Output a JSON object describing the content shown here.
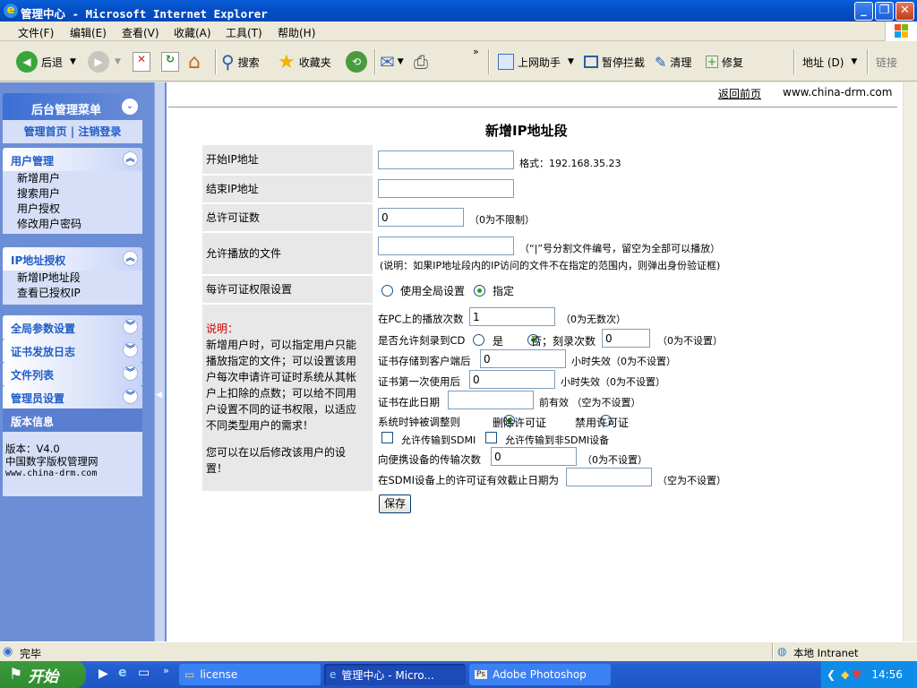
{
  "window": {
    "title": "管理中心 - Microsoft Internet Explorer"
  },
  "menu": [
    "文件(F)",
    "编辑(E)",
    "查看(V)",
    "收藏(A)",
    "工具(T)",
    "帮助(H)"
  ],
  "toolbar": {
    "back": "后退",
    "search": "搜索",
    "favorites": "收藏夹",
    "helper": "上网助手",
    "block": "暂停拦截",
    "clean": "清理",
    "repair": "修复",
    "address": "地址 (D)",
    "links": "链接"
  },
  "sidebar": {
    "header": "后台管理菜单",
    "top_links": [
      "管理首页",
      "注销登录"
    ],
    "sections": [
      {
        "title": "用户管理",
        "items": [
          "新增用户",
          "搜索用户",
          "用户授权",
          "修改用户密码"
        ]
      },
      {
        "title": "IP地址授权",
        "items": [
          "新增IP地址段",
          "查看已授权IP"
        ]
      },
      {
        "title": "全局参数设置",
        "items": []
      },
      {
        "title": "证书发放日志",
        "items": []
      },
      {
        "title": "文件列表",
        "items": []
      },
      {
        "title": "管理员设置",
        "items": []
      }
    ],
    "version": {
      "title": "版本信息",
      "line1": "版本：V4.0",
      "line2": "中国数字版权管理网",
      "line3": "www.china-drm.com"
    }
  },
  "page": {
    "back_link": "返回前页",
    "site": "www.china-drm.com",
    "title": "新增IP地址段",
    "start_ip_label": "开始IP地址",
    "start_ip_value": "",
    "format_hint": "格式：192.168.35.23",
    "end_ip_label": "结束IP地址",
    "end_ip_value": "",
    "total_label": "总许可证数",
    "total_value": "0",
    "total_hint": "（0为不限制）",
    "files_label": "允许播放的文件",
    "files_value": "",
    "files_hint": "（“|”号分割文件编号，留空为全部可以播放）",
    "files_note": "(说明：如果IP地址段内的IP访问的文件不在指定的范围内，则弹出身份验证框)",
    "rights_label": "每许可证权限设置",
    "opt_global": "使用全局设置",
    "opt_custom": "指定",
    "note_title": "说明：",
    "note_body": "新增用户时，可以指定用户只能播放指定的文件；可以设置该用户每次申请许可证时系统从其帐户上扣除的点数；可以给不同用户设置不同的证书权限，以适应不同类型用户的需求！",
    "note_tail": "您可以在以后修改该用户的设置！",
    "pc_label": "在PC上的播放次数",
    "pc_value": "1",
    "pc_hint": "（0为无数次）",
    "burn_label": "是否允许刻录到CD",
    "yes": "是",
    "no": "否；刻录次数",
    "burn_value": "0",
    "burn_hint": "（0为不设置）",
    "store_label": "证书存储到客户端后",
    "store_value": "0",
    "store_hint": "小时失效（0为不设置）",
    "first_label": "证书第一次使用后",
    "first_value": "0",
    "first_hint": "小时失效（0为不设置）",
    "date_label": "证书在此日期",
    "date_value": "",
    "date_hint": "前有效 （空为不设置）",
    "clock_label": "系统时钟被调整则",
    "del_lic": "删除许可证",
    "dis_lic": "禁用许可证",
    "sdmi": "允许传输到SDMI",
    "nonsdmi": "允许传输到非SDMI设备",
    "portable_label": "向便携设备的传输次数",
    "portable_value": "0",
    "portable_hint": "（0为不设置）",
    "sdmi_date_label": "在SDMI设备上的许可证有效截止日期为",
    "sdmi_date_value": "",
    "sdmi_date_hint": "（空为不设置）",
    "save": "保存"
  },
  "status": {
    "left": "完毕",
    "zone": "本地 Intranet"
  },
  "taskbar": {
    "start": "开始",
    "tasks": [
      "license",
      "管理中心 - Micro...",
      "Adobe Photoshop"
    ],
    "clock": "14:56"
  }
}
